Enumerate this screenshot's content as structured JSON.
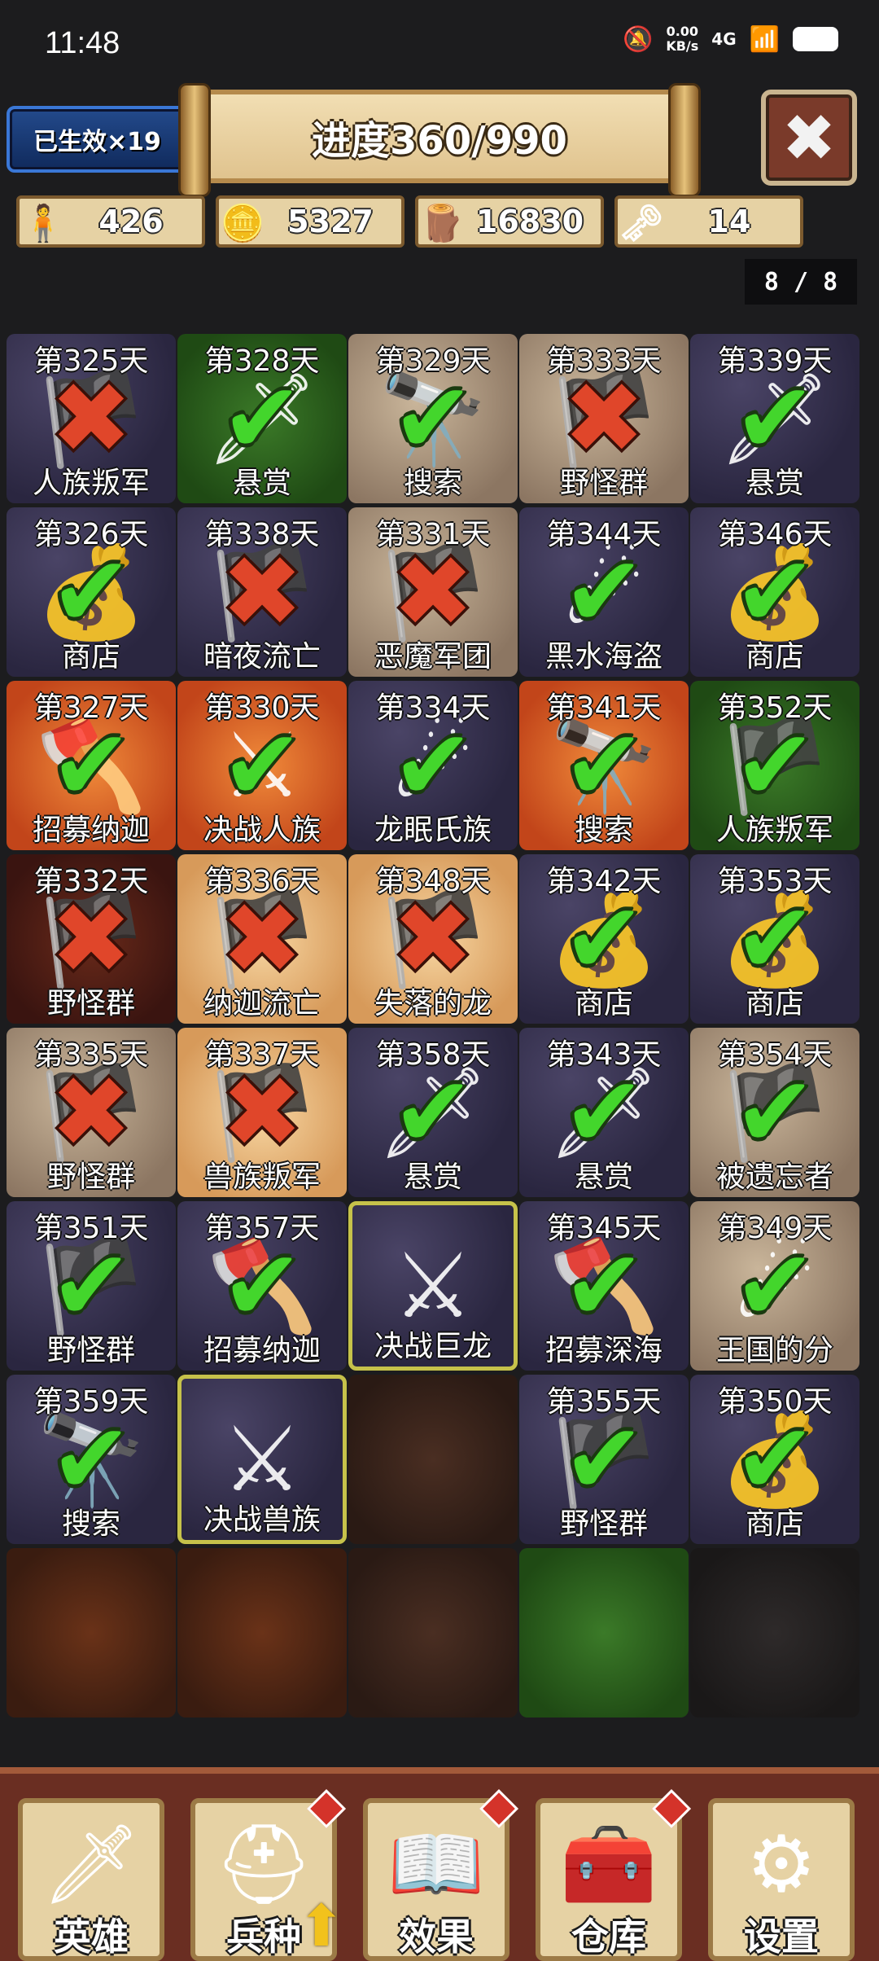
{
  "status_bar": {
    "time": "11:48",
    "speed_value": "0.00",
    "speed_unit": "KB/s",
    "network": "4G"
  },
  "header": {
    "badge_text": "已生效×19",
    "progress_text": "进度360/990",
    "close_icon": "close-icon"
  },
  "resources": [
    {
      "icon": "population-icon",
      "value": "426"
    },
    {
      "icon": "gold-coins-icon",
      "value": "5327"
    },
    {
      "icon": "wood-logs-icon",
      "value": "16830"
    },
    {
      "icon": "key-icon",
      "value": "14"
    }
  ],
  "pager": "8 / 8",
  "events": [
    [
      {
        "day": "第325天",
        "label": "人族叛军",
        "result": "fail",
        "bg": "stone",
        "icon": "banner-icon"
      },
      {
        "day": "第328天",
        "label": "悬赏",
        "result": "success",
        "bg": "grass",
        "icon": "dagger-icon"
      },
      {
        "day": "第329天",
        "label": "搜索",
        "result": "success",
        "bg": "cobble",
        "icon": "spyglass-icon"
      },
      {
        "day": "第333天",
        "label": "野怪群",
        "result": "fail",
        "bg": "cobble",
        "icon": "banner-icon"
      },
      {
        "day": "第339天",
        "label": "悬赏",
        "result": "success",
        "bg": "stone",
        "icon": "dagger-icon"
      }
    ],
    [
      {
        "day": "第326天",
        "label": "商店",
        "result": "success",
        "bg": "stone",
        "icon": "treasure-bag-icon"
      },
      {
        "day": "第338天",
        "label": "暗夜流亡",
        "result": "fail",
        "bg": "stone",
        "icon": "banner-icon"
      },
      {
        "day": "第331天",
        "label": "恶魔军团",
        "result": "fail",
        "bg": "cobble",
        "icon": "banner-icon"
      },
      {
        "day": "第344天",
        "label": "黑水海盗",
        "result": "success",
        "bg": "stone",
        "icon": "meteor-icon"
      },
      {
        "day": "第346天",
        "label": "商店",
        "result": "success",
        "bg": "stone",
        "icon": "treasure-bag-icon"
      }
    ],
    [
      {
        "day": "第327天",
        "label": "招募纳迦",
        "result": "success",
        "bg": "lava",
        "icon": "crossed-axes-icon"
      },
      {
        "day": "第330天",
        "label": "决战人族",
        "result": "success",
        "bg": "lava",
        "icon": "crossed-swords-icon"
      },
      {
        "day": "第334天",
        "label": "龙眠氏族",
        "result": "success",
        "bg": "stone",
        "icon": "meteor-icon"
      },
      {
        "day": "第341天",
        "label": "搜索",
        "result": "success",
        "bg": "lava",
        "icon": "spyglass-icon"
      },
      {
        "day": "第352天",
        "label": "人族叛军",
        "result": "success",
        "bg": "grass",
        "icon": "banner-icon"
      }
    ],
    [
      {
        "day": "第332天",
        "label": "野怪群",
        "result": "fail",
        "bg": "rust",
        "icon": "banner-icon"
      },
      {
        "day": "第336天",
        "label": "纳迦流亡",
        "result": "fail",
        "bg": "sand",
        "icon": "banner-icon"
      },
      {
        "day": "第348天",
        "label": "失落的龙",
        "result": "fail",
        "bg": "sand",
        "icon": "banner-icon"
      },
      {
        "day": "第342天",
        "label": "商店",
        "result": "success",
        "bg": "stone",
        "icon": "treasure-bag-icon"
      },
      {
        "day": "第353天",
        "label": "商店",
        "result": "success",
        "bg": "stone",
        "icon": "treasure-bag-icon"
      }
    ],
    [
      {
        "day": "第335天",
        "label": "野怪群",
        "result": "fail",
        "bg": "cobble",
        "icon": "banner-icon"
      },
      {
        "day": "第337天",
        "label": "兽族叛军",
        "result": "fail",
        "bg": "sand",
        "icon": "banner-icon"
      },
      {
        "day": "第358天",
        "label": "悬赏",
        "result": "success",
        "bg": "stone",
        "icon": "dagger-icon"
      },
      {
        "day": "第343天",
        "label": "悬赏",
        "result": "success",
        "bg": "stone",
        "icon": "dagger-icon"
      },
      {
        "day": "第354天",
        "label": "被遗忘者",
        "result": "success",
        "bg": "cobble",
        "icon": "banner-icon"
      }
    ],
    [
      {
        "day": "第351天",
        "label": "野怪群",
        "result": "success",
        "bg": "stone",
        "icon": "banner-icon"
      },
      {
        "day": "第357天",
        "label": "招募纳迦",
        "result": "success",
        "bg": "stone",
        "icon": "crossed-axes-icon"
      },
      {
        "day": "",
        "label": "决战巨龙",
        "result": "pending",
        "bg": "stone",
        "icon": "crossed-swords-icon",
        "selected": true
      },
      {
        "day": "第345天",
        "label": "招募深海",
        "result": "success",
        "bg": "stone",
        "icon": "crossed-axes-icon"
      },
      {
        "day": "第349天",
        "label": "王国的分",
        "result": "success",
        "bg": "cobble",
        "icon": "meteor-icon"
      }
    ],
    [
      {
        "day": "第359天",
        "label": "搜索",
        "result": "success",
        "bg": "stone",
        "icon": "spyglass-icon"
      },
      {
        "day": "",
        "label": "决战兽族",
        "result": "pending",
        "bg": "stone",
        "icon": "crossed-swords-icon",
        "selected": true
      },
      {
        "day": "",
        "label": "",
        "result": "empty",
        "bg": "dirt",
        "icon": ""
      },
      {
        "day": "第355天",
        "label": "野怪群",
        "result": "success",
        "bg": "stone",
        "icon": "banner-icon"
      },
      {
        "day": "第350天",
        "label": "商店",
        "result": "success",
        "bg": "stone",
        "icon": "treasure-bag-icon"
      }
    ],
    [
      {
        "day": "",
        "label": "",
        "result": "empty",
        "bg": "soil",
        "icon": ""
      },
      {
        "day": "",
        "label": "",
        "result": "empty",
        "bg": "soil",
        "icon": ""
      },
      {
        "day": "",
        "label": "",
        "result": "empty",
        "bg": "dirt",
        "icon": ""
      },
      {
        "day": "",
        "label": "",
        "result": "empty",
        "bg": "grass",
        "icon": ""
      },
      {
        "day": "",
        "label": "",
        "result": "empty",
        "bg": "dark",
        "icon": ""
      }
    ]
  ],
  "bottom_nav": [
    {
      "label": "英雄",
      "icon": "sword-icon",
      "notify": false,
      "upgrade": false
    },
    {
      "label": "兵种",
      "icon": "knight-helmet-icon",
      "notify": true,
      "upgrade": true
    },
    {
      "label": "效果",
      "icon": "spellbook-icon",
      "notify": true,
      "upgrade": false
    },
    {
      "label": "仓库",
      "icon": "treasure-chest-icon",
      "notify": true,
      "upgrade": false
    },
    {
      "label": "设置",
      "icon": "gear-icon",
      "notify": false,
      "upgrade": false
    }
  ],
  "colors": {
    "success": "#43d62c",
    "fail": "#e0462a",
    "selected_border": "#c6c24a",
    "nav_bar": "#6a2e22"
  }
}
